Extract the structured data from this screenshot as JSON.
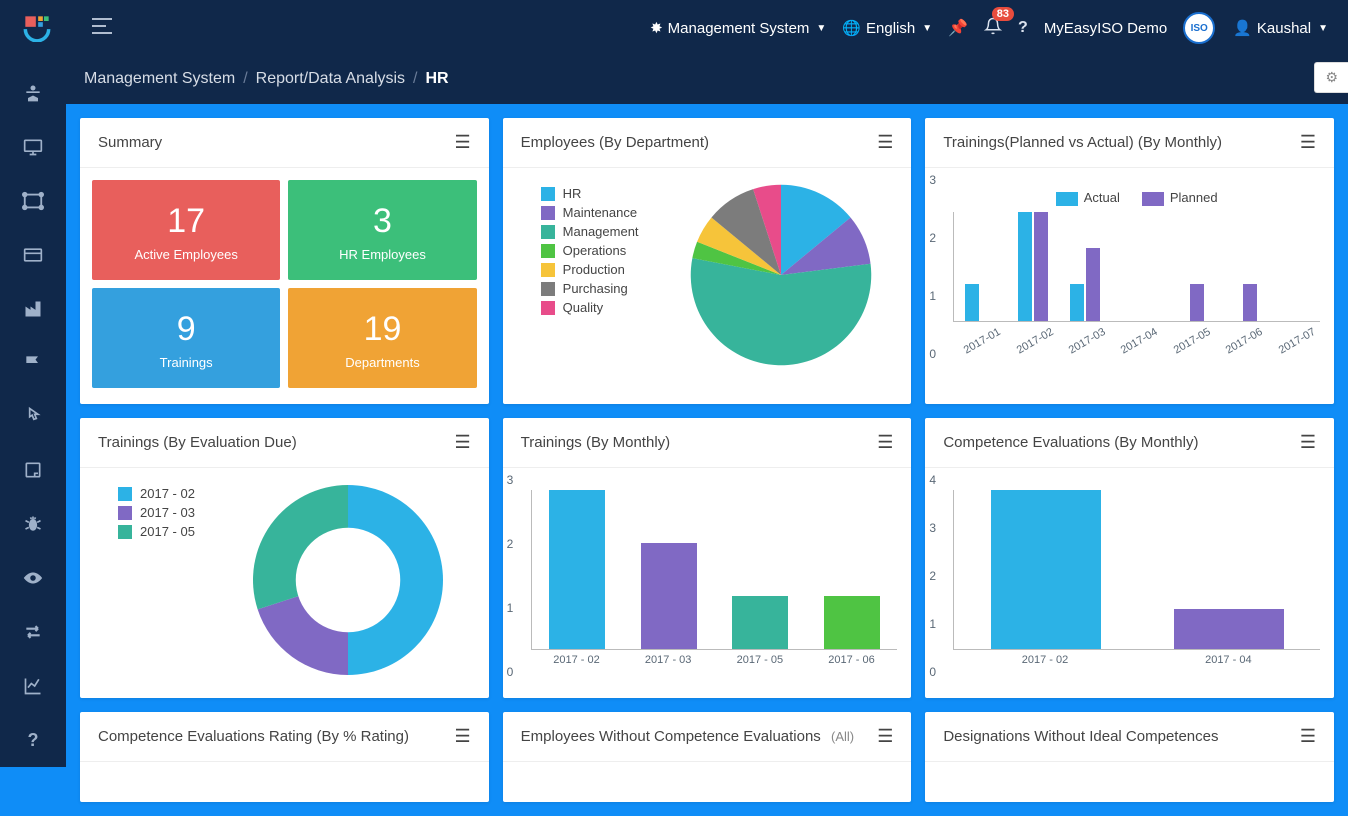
{
  "topbar": {
    "management_system": "Management System",
    "language": "English",
    "notifications_count": "83",
    "company": "MyEasyISO Demo",
    "user": "Kaushal",
    "avatar_text": "ISO"
  },
  "breadcrumb": {
    "a": "Management System",
    "b": "Report/Data Analysis",
    "c": "HR"
  },
  "panels": {
    "summary": {
      "title": "Summary",
      "stats": [
        {
          "num": "17",
          "lbl": "Active Employees",
          "cls": "red"
        },
        {
          "num": "3",
          "lbl": "HR Employees",
          "cls": "green"
        },
        {
          "num": "9",
          "lbl": "Trainings",
          "cls": "blue"
        },
        {
          "num": "19",
          "lbl": "Departments",
          "cls": "orange"
        }
      ]
    },
    "emp_dept": {
      "title": "Employees (By Department)",
      "legend": [
        {
          "label": "HR",
          "color": "#2cb2e6"
        },
        {
          "label": "Maintenance",
          "color": "#8069c4"
        },
        {
          "label": "Management",
          "color": "#37b49b"
        },
        {
          "label": "Operations",
          "color": "#4fc443"
        },
        {
          "label": "Production",
          "color": "#f6c43a"
        },
        {
          "label": "Purchasing",
          "color": "#7c7c7c"
        },
        {
          "label": "Quality",
          "color": "#e84c8a"
        }
      ]
    },
    "trainings_pva": {
      "title": "Trainings(Planned vs Actual) (By Monthly)",
      "legend": {
        "actual": "Actual",
        "planned": "Planned"
      }
    },
    "trainings_due": {
      "title": "Trainings (By Evaluation Due)",
      "legend": [
        {
          "label": "2017 - 02",
          "color": "#2cb2e6"
        },
        {
          "label": "2017 - 03",
          "color": "#8069c4"
        },
        {
          "label": "2017 - 05",
          "color": "#37b49b"
        }
      ]
    },
    "trainings_monthly": {
      "title": "Trainings (By Monthly)"
    },
    "competence_monthly": {
      "title": "Competence Evaluations (By Monthly)"
    },
    "comp_rating": {
      "title": "Competence Evaluations Rating (By % Rating)"
    },
    "emp_without": {
      "title": "Employees Without Competence Evaluations",
      "sub": "(All)"
    },
    "desig_without": {
      "title": "Designations Without Ideal Competences"
    }
  },
  "chart_data": {
    "emp_dept_pie": {
      "type": "pie",
      "slices": [
        {
          "label": "HR",
          "value": 14,
          "color": "#2cb2e6"
        },
        {
          "label": "Maintenance",
          "value": 9,
          "color": "#8069c4"
        },
        {
          "label": "Management",
          "value": 55,
          "color": "#37b49b"
        },
        {
          "label": "Operations",
          "value": 3,
          "color": "#4fc443"
        },
        {
          "label": "Production",
          "value": 5,
          "color": "#f6c43a"
        },
        {
          "label": "Purchasing",
          "value": 9,
          "color": "#7c7c7c"
        },
        {
          "label": "Quality",
          "value": 5,
          "color": "#e84c8a"
        }
      ]
    },
    "trainings_pva": {
      "type": "bar",
      "categories": [
        "2017-01",
        "2017-02",
        "2017-03",
        "2017-04",
        "2017-05",
        "2017-06",
        "2017-07"
      ],
      "series": [
        {
          "name": "Actual",
          "color": "#2cb2e6",
          "values": [
            1,
            3,
            1,
            0,
            0,
            0,
            0
          ]
        },
        {
          "name": "Planned",
          "color": "#8069c4",
          "values": [
            0,
            3,
            2,
            0,
            1,
            1,
            0
          ]
        }
      ],
      "ylim": [
        0,
        3
      ],
      "yticks": [
        0,
        1,
        2,
        3
      ]
    },
    "trainings_due_donut": {
      "type": "pie",
      "hole": 0.55,
      "slices": [
        {
          "label": "2017 - 02",
          "value": 50,
          "color": "#2cb2e6"
        },
        {
          "label": "2017 - 03",
          "value": 20,
          "color": "#8069c4"
        },
        {
          "label": "2017 - 05",
          "value": 30,
          "color": "#37b49b"
        }
      ]
    },
    "trainings_monthly": {
      "type": "bar",
      "categories": [
        "2017 - 02",
        "2017 - 03",
        "2017 - 05",
        "2017 - 06"
      ],
      "series": [
        {
          "name": "",
          "values": [
            3,
            2,
            1,
            1
          ],
          "colors": [
            "#2cb2e6",
            "#8069c4",
            "#37b49b",
            "#4fc443"
          ]
        }
      ],
      "ylim": [
        0,
        3
      ],
      "yticks": [
        0,
        1,
        2,
        3
      ]
    },
    "competence_monthly": {
      "type": "bar",
      "categories": [
        "2017 - 02",
        "2017 - 04"
      ],
      "series": [
        {
          "name": "",
          "values": [
            4,
            1
          ],
          "colors": [
            "#2cb2e6",
            "#8069c4"
          ]
        }
      ],
      "ylim": [
        0,
        4
      ],
      "yticks": [
        0,
        1,
        2,
        3,
        4
      ]
    }
  }
}
